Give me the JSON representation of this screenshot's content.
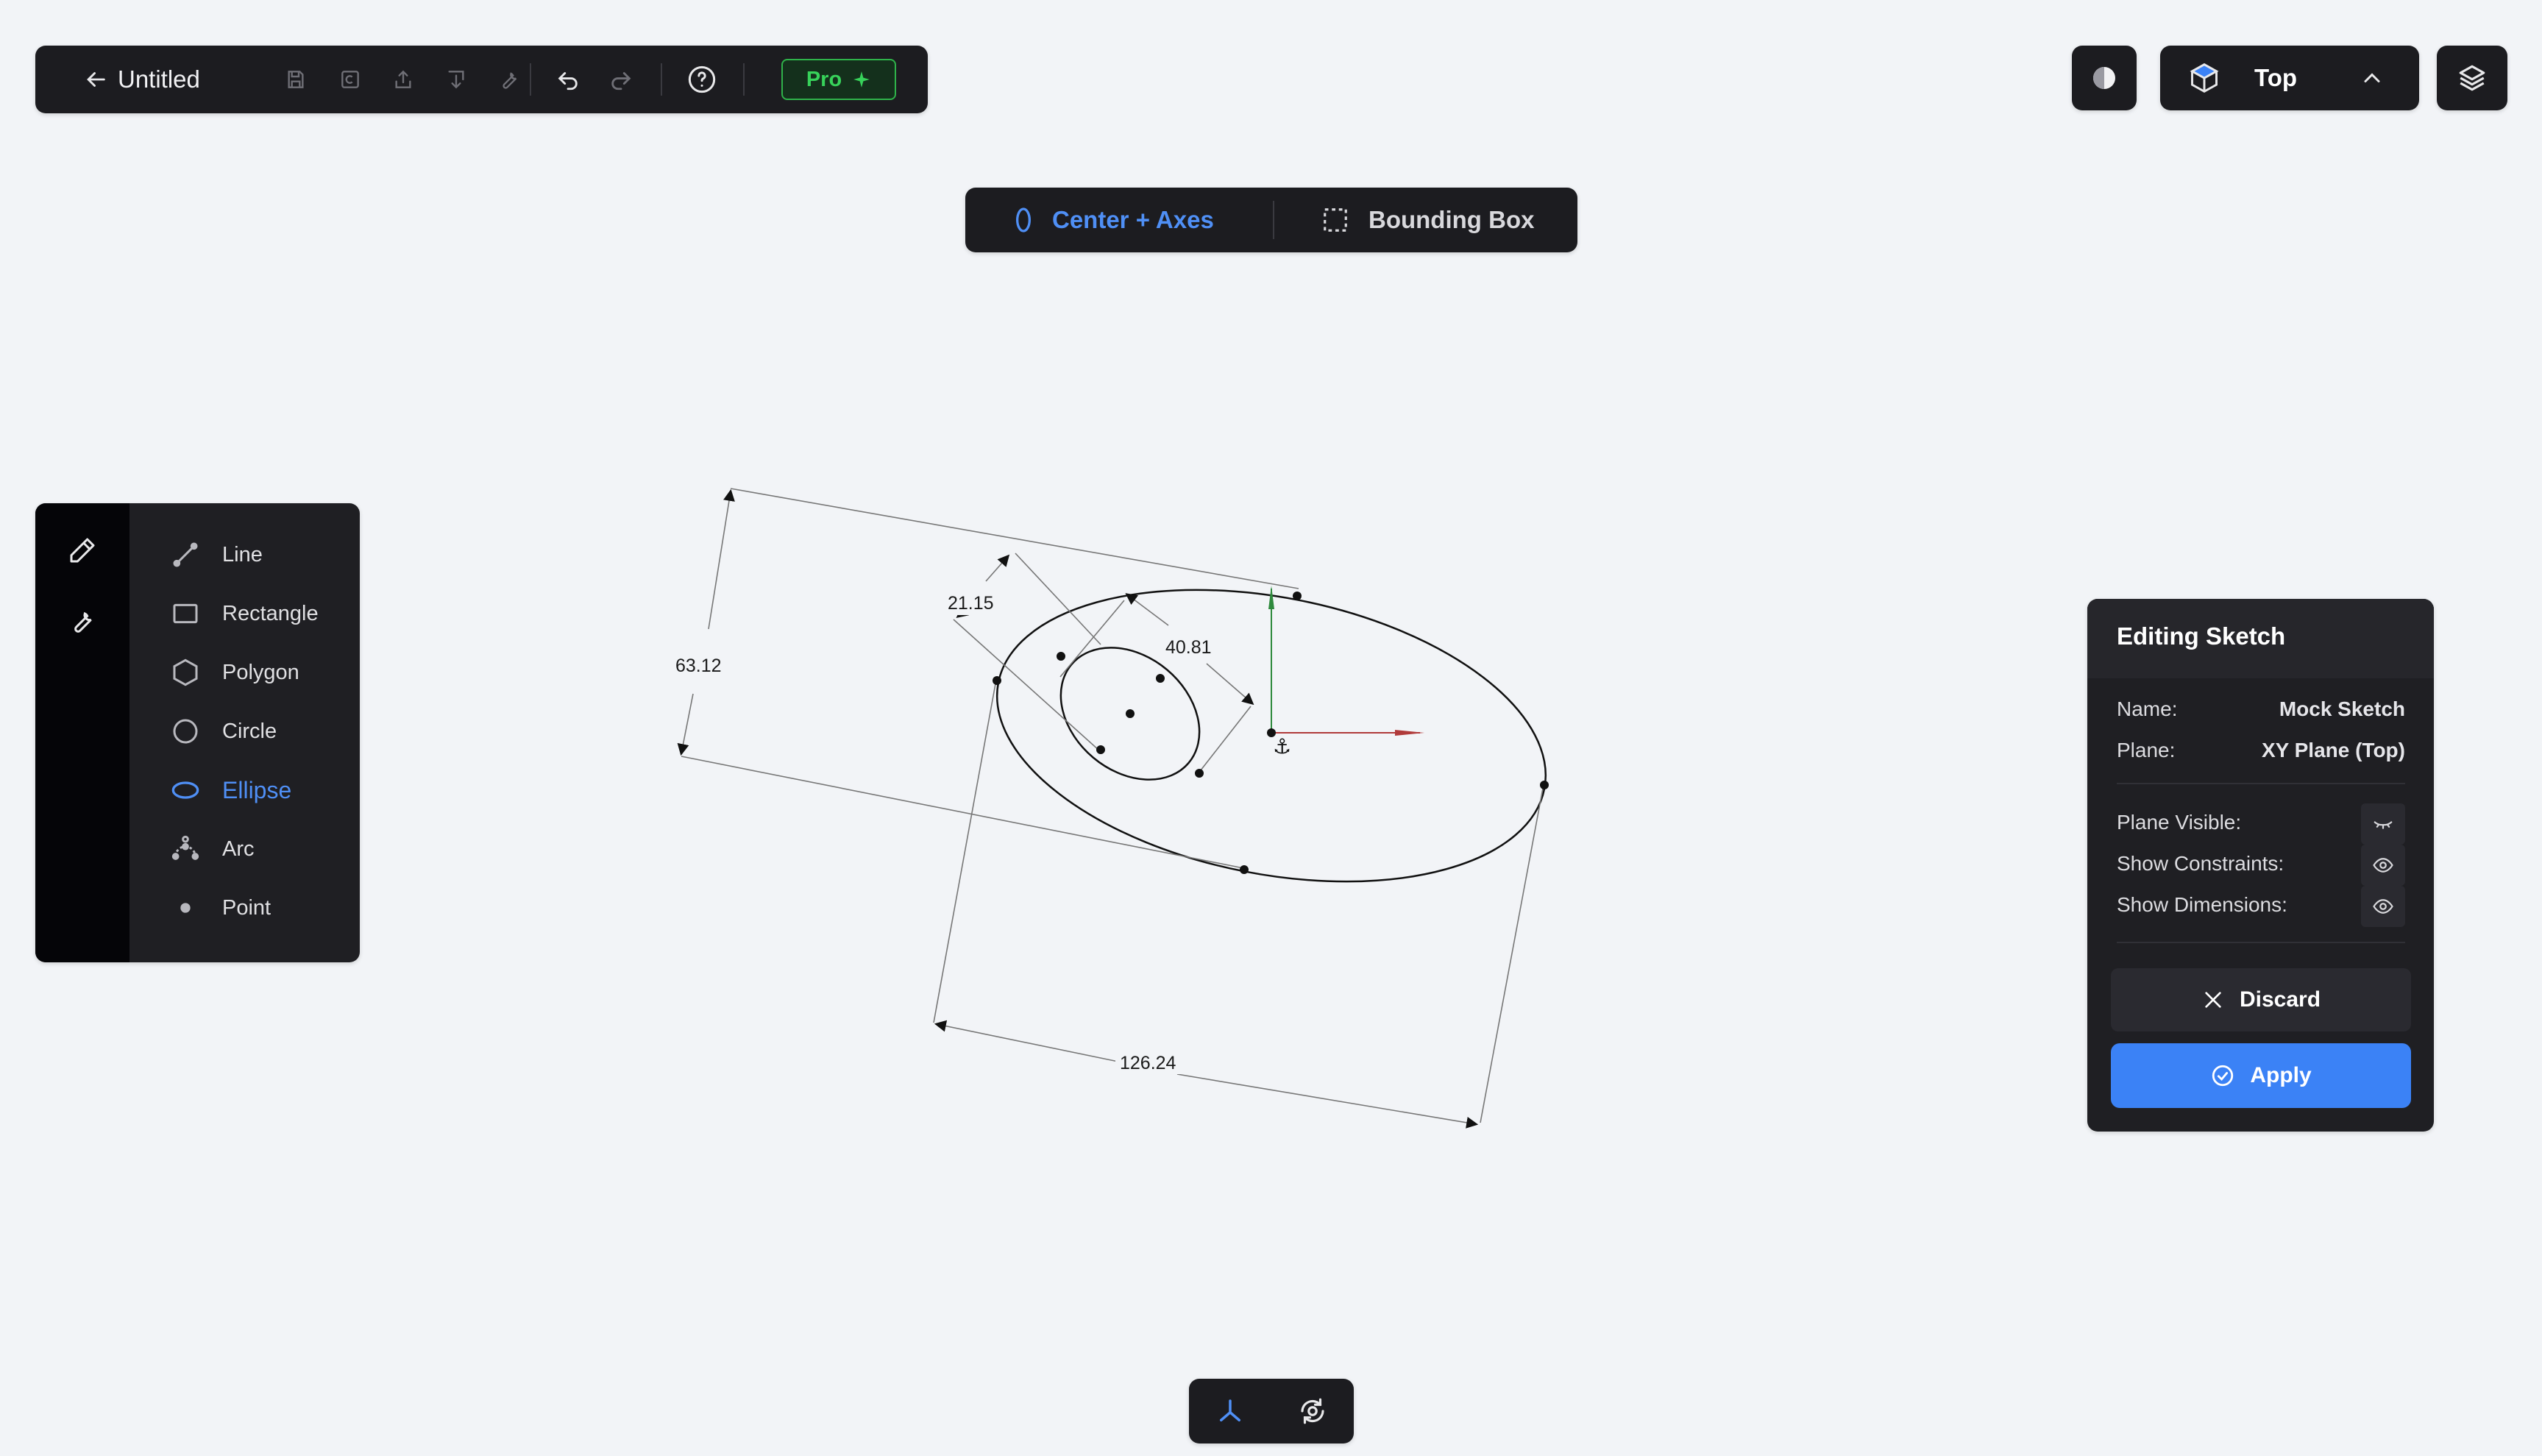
{
  "toolbar": {
    "title": "Untitled",
    "pro_label": "Pro",
    "icons": [
      "back-arrow-icon",
      "save-icon",
      "copy-icon",
      "upload-icon",
      "download-icon",
      "wrench-icon",
      "undo-icon",
      "redo-icon",
      "help-icon",
      "sparkle-icon"
    ]
  },
  "top_right": {
    "view_label": "Top",
    "icons": [
      "theme-icon",
      "cube-icon",
      "chevron-up-icon",
      "layers-icon"
    ]
  },
  "mode": {
    "center_axes_label": "Center + Axes",
    "bounding_box_label": "Bounding Box",
    "active": "Center + Axes"
  },
  "tools": {
    "rail_icons": [
      "pencil-icon",
      "wrench-icon"
    ],
    "items": [
      {
        "label": "Line",
        "icon": "line-icon"
      },
      {
        "label": "Rectangle",
        "icon": "rectangle-icon"
      },
      {
        "label": "Polygon",
        "icon": "polygon-icon"
      },
      {
        "label": "Circle",
        "icon": "circle-icon"
      },
      {
        "label": "Ellipse",
        "icon": "ellipse-icon"
      },
      {
        "label": "Arc",
        "icon": "arc-icon"
      },
      {
        "label": "Point",
        "icon": "point-icon"
      }
    ],
    "active": "Ellipse"
  },
  "canvas": {
    "dimensions": {
      "d1": "63.12",
      "d2": "21.15",
      "d3": "40.81",
      "d4": "126.24"
    },
    "colors": {
      "x_axis": "#b03a3a",
      "y_axis": "#2f8a3d",
      "accent": "#3b82f6"
    }
  },
  "editing": {
    "title": "Editing Sketch",
    "name_label": "Name:",
    "name_value": "Mock Sketch",
    "plane_label": "Plane:",
    "plane_value": "XY Plane (Top)",
    "plane_visible_label": "Plane Visible:",
    "show_constraints_label": "Show Constraints:",
    "show_dimensions_label": "Show Dimensions:",
    "discard_label": "Discard",
    "apply_label": "Apply"
  },
  "bottom": {
    "icons": [
      "axes-icon",
      "orbit-icon"
    ]
  }
}
